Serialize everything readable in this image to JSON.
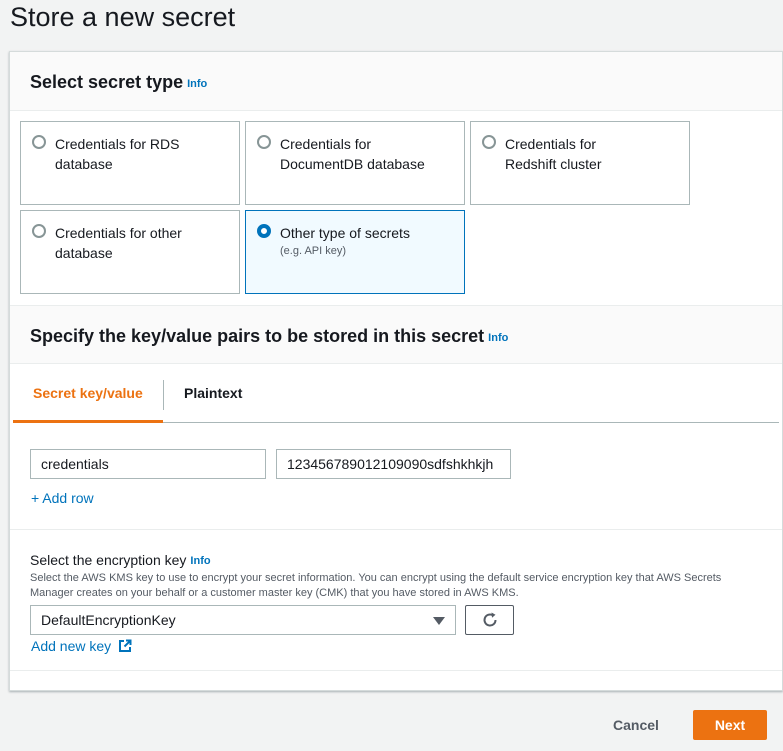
{
  "page": {
    "title": "Store a new secret"
  },
  "secret_type": {
    "title": "Select secret type",
    "info": "Info",
    "options": [
      {
        "label": "Credentials for RDS database",
        "desc": "",
        "selected": false
      },
      {
        "label": "Credentials for DocumentDB database",
        "desc": "",
        "selected": false
      },
      {
        "label": "Credentials for Redshift cluster",
        "desc": "",
        "selected": false
      },
      {
        "label": "Credentials for other database",
        "desc": "",
        "selected": false
      },
      {
        "label": "Other type of secrets",
        "desc": "(e.g. API key)",
        "selected": true
      }
    ]
  },
  "kv_section": {
    "title": "Specify the key/value pairs to be stored in this secret",
    "info": "Info",
    "tabs": [
      {
        "label": "Secret key/value",
        "active": true
      },
      {
        "label": "Plaintext",
        "active": false
      }
    ],
    "rows": [
      {
        "key": "credentials",
        "value": "123456789012109090sdfshkhkjh"
      }
    ],
    "add_row": "+ Add row"
  },
  "encryption": {
    "label": "Select the encryption key",
    "info": "Info",
    "description": "Select the AWS KMS key to use to encrypt your secret information. You can encrypt using the default service encryption key that AWS Secrets Manager creates on your behalf or a customer master key (CMK) that you have stored in AWS KMS.",
    "selected": "DefaultEncryptionKey",
    "add_key": "Add new key"
  },
  "footer": {
    "cancel": "Cancel",
    "next": "Next"
  },
  "colors": {
    "accent": "#ec7211",
    "link": "#0073bb"
  }
}
